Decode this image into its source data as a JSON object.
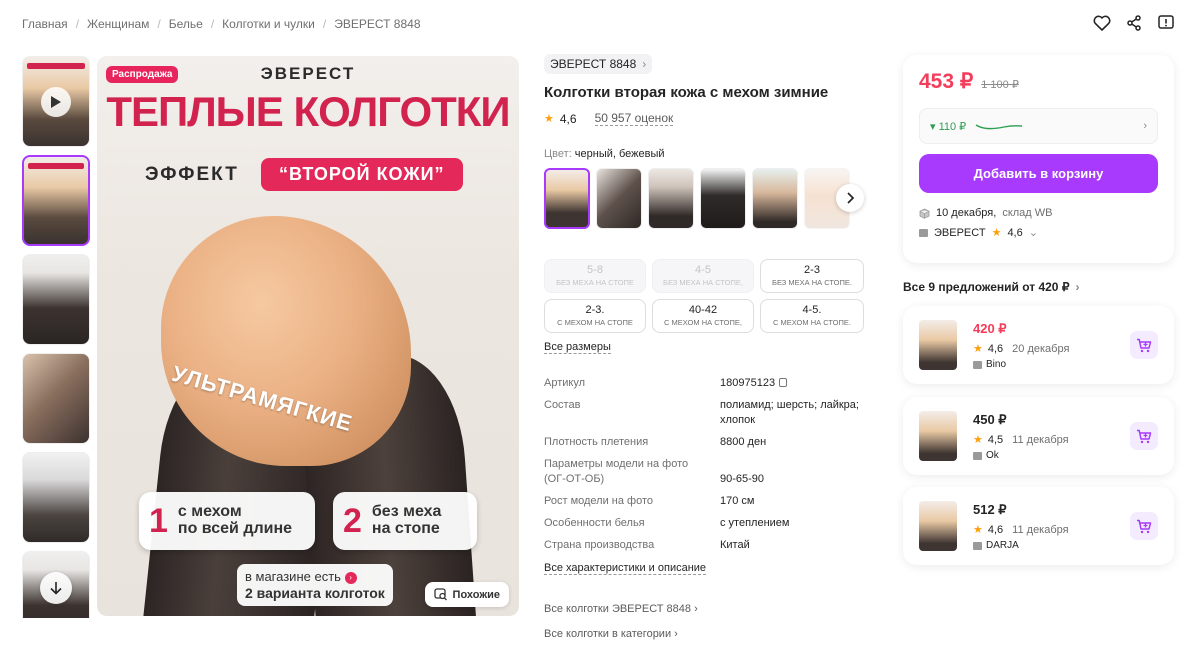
{
  "breadcrumb": [
    "Главная",
    "Женщинам",
    "Белье",
    "Колготки и чулки",
    "ЭВЕРЕСТ 8848"
  ],
  "top_icons": [
    "heart-icon",
    "share-icon",
    "report-icon"
  ],
  "main_image": {
    "sale_badge": "Распродажа",
    "brand": "ЭВЕРЕСТ",
    "headline": "ТЕПЛЫЕ КОЛГОТКИ",
    "effect": "ЭФФЕКТ",
    "second_skin": "“ВТОРОЙ КОЖИ”",
    "ultra_soft": "УЛЬТРАМЯГКИЕ",
    "option1_num": "1",
    "option1_text_a": "с мехом",
    "option1_text_b": "по всей длине",
    "option2_num": "2",
    "option2_text_a": "без меха",
    "option2_text_b": "на стопе",
    "store_note_a": "в магазине есть",
    "store_note_b": "2 варианта колготок",
    "similar_label": "Похожие"
  },
  "product": {
    "brand_chip": "ЭВЕРЕСТ 8848",
    "title": "Колготки вторая кожа с мехом зимние",
    "rating": "4,6",
    "reviews": "50 957 оценок",
    "color_label": "Цвет:",
    "color_value": "черный, бежевый"
  },
  "sizes": [
    {
      "size": "5-8",
      "note": "БЕЗ МЕХА НА СТОПЕ",
      "disabled": true
    },
    {
      "size": "4-5",
      "note": "БЕЗ МЕХА НА СТОПЕ,",
      "disabled": true
    },
    {
      "size": "2-3",
      "note": "БЕЗ МЕХА НА СТОПЕ.",
      "disabled": false
    },
    {
      "size": "2-3.",
      "note": "С МЕХОМ НА СТОПЕ",
      "disabled": false
    },
    {
      "size": "40-42",
      "note": "С МЕХОМ НА СТОПЕ,",
      "disabled": false
    },
    {
      "size": "4-5.",
      "note": "С МЕХОМ НА СТОПЕ.",
      "disabled": false
    }
  ],
  "all_sizes_link": "Все размеры",
  "specs": [
    {
      "key": "Артикул",
      "value": "180975123"
    },
    {
      "key": "Состав",
      "value": "полиамид; шерсть; лайкра; хлопок"
    },
    {
      "key": "Плотность плетения",
      "value": "8800 ден"
    },
    {
      "key": "Параметры модели на фото (ОГ-ОТ-ОБ)",
      "value": "90-65-90"
    },
    {
      "key": "Рост модели на фото",
      "value": "170 см"
    },
    {
      "key": "Особенности белья",
      "value": "с утеплением"
    },
    {
      "key": "Страна производства",
      "value": "Китай"
    }
  ],
  "all_characteristics_link": "Все характеристики и описание",
  "all_brand_link": "Все колготки ЭВЕРЕСТ 8848",
  "all_category_link": "Все колготки в категории",
  "price_card": {
    "price": "453 ₽",
    "old_price": "1 100 ₽",
    "wallet_discount": "▾ 110 ₽",
    "add_to_cart": "Добавить в корзину",
    "delivery_date": "10 декабря,",
    "delivery_from": "склад WB",
    "seller": "ЭВЕРЕСТ",
    "seller_rating": "4,6"
  },
  "offers_title": "Все 9 предложений от 420 ₽",
  "offers": [
    {
      "price": "420 ₽",
      "highlight": true,
      "rating": "4,6",
      "date": "20 декабря",
      "seller": "Bino"
    },
    {
      "price": "450 ₽",
      "highlight": false,
      "rating": "4,5",
      "date": "11 декабря",
      "seller": "Ok"
    },
    {
      "price": "512 ₽",
      "highlight": false,
      "rating": "4,6",
      "date": "11 декабря",
      "seller": "DARJA"
    }
  ],
  "colors": {
    "accent": "#a73afd",
    "price": "#f33d5a",
    "brand_red": "#d2234f",
    "wallet_green": "#2c9e51"
  }
}
